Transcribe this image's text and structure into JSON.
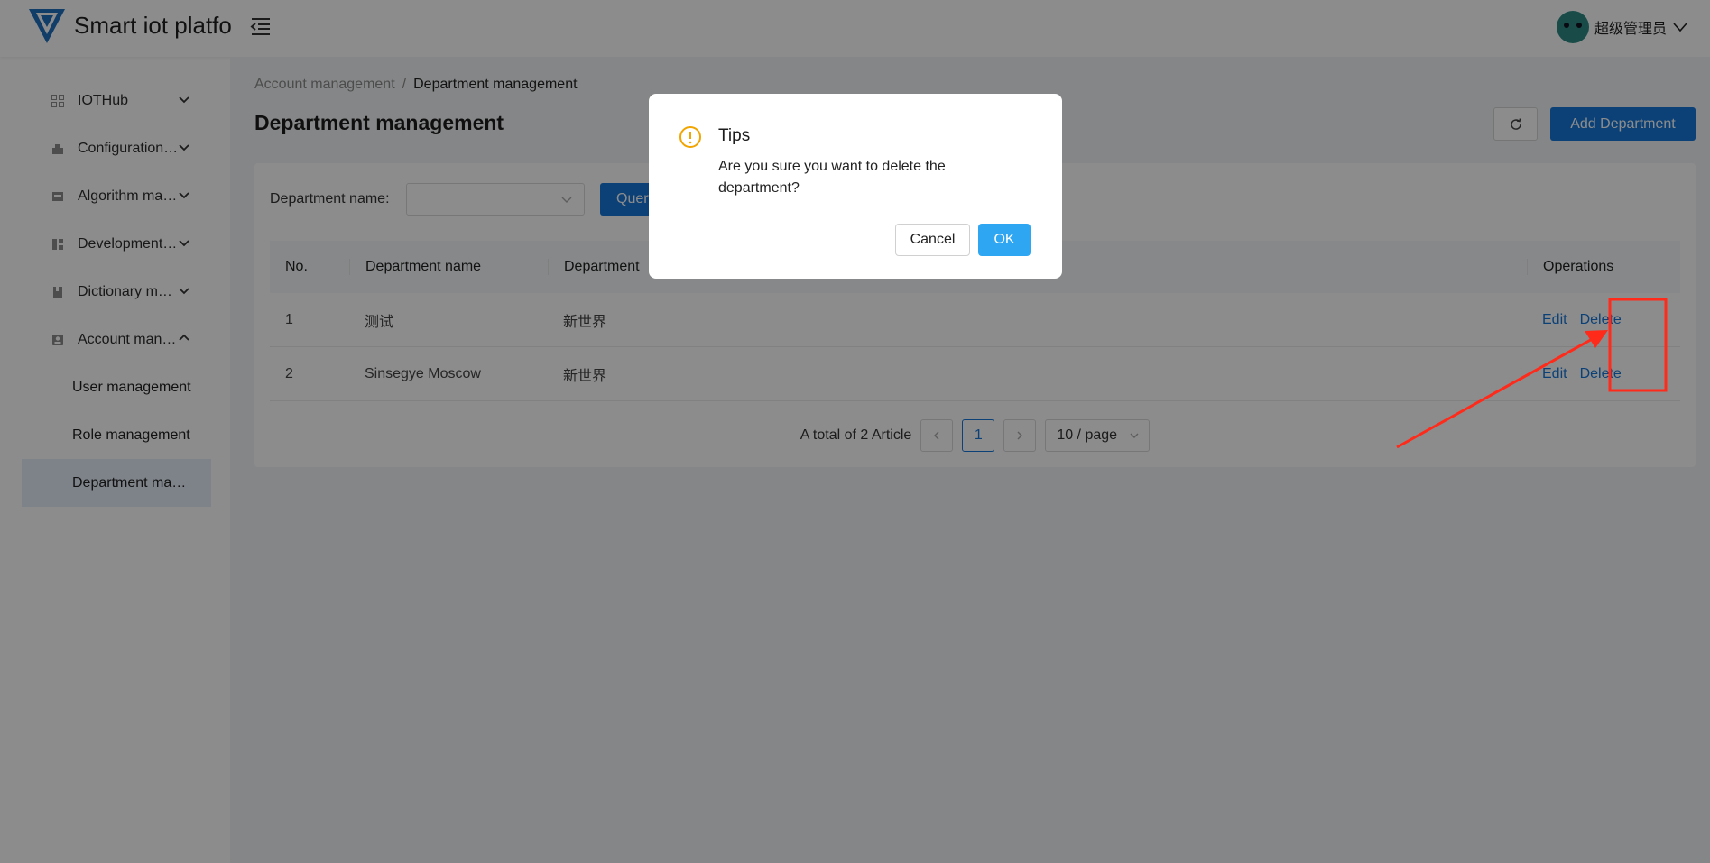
{
  "header": {
    "app_title": "Smart iot platform",
    "user_name": "超级管理员"
  },
  "sidebar": {
    "items": [
      {
        "label": "IOTHub",
        "icon": "grid-icon",
        "expanded": false
      },
      {
        "label": "Configuration management",
        "icon": "configuration-icon",
        "expanded": false
      },
      {
        "label": "Algorithm management",
        "icon": "algorithm-icon",
        "expanded": false
      },
      {
        "label": "Development management",
        "icon": "development-icon",
        "expanded": false
      },
      {
        "label": "Dictionary management",
        "icon": "dictionary-icon",
        "expanded": false
      },
      {
        "label": "Account management",
        "icon": "account-icon",
        "expanded": true
      }
    ],
    "sub_items": [
      {
        "label": "User management",
        "active": false
      },
      {
        "label": "Role management",
        "active": false
      },
      {
        "label": "Department management",
        "active": true
      }
    ]
  },
  "breadcrumb": {
    "parent": "Account management",
    "separator": "/",
    "current": "Department management"
  },
  "page": {
    "title": "Department management",
    "add_button": "Add Department"
  },
  "filter": {
    "label": "Department name:",
    "select_value": "",
    "query_button": "Query"
  },
  "table": {
    "columns": [
      "No.",
      "Department name",
      "Department",
      "Operations"
    ],
    "rows": [
      {
        "no": "1",
        "name": "测试",
        "parent": "新世界",
        "edit": "Edit",
        "delete": "Delete"
      },
      {
        "no": "2",
        "name": "Sinsegye Moscow",
        "parent": "新世界",
        "edit": "Edit",
        "delete": "Delete"
      }
    ]
  },
  "pagination": {
    "total": "A total of 2 Article",
    "current_page": "1",
    "page_size": "10 / page"
  },
  "dialog": {
    "title": "Tips",
    "message": "Are you sure you want to delete the department?",
    "cancel": "Cancel",
    "ok": "OK"
  },
  "colors": {
    "primary": "#1677d9",
    "ok_button": "#2fa6f2",
    "warning": "#f0a500",
    "annotation": "#ff2a1a"
  }
}
